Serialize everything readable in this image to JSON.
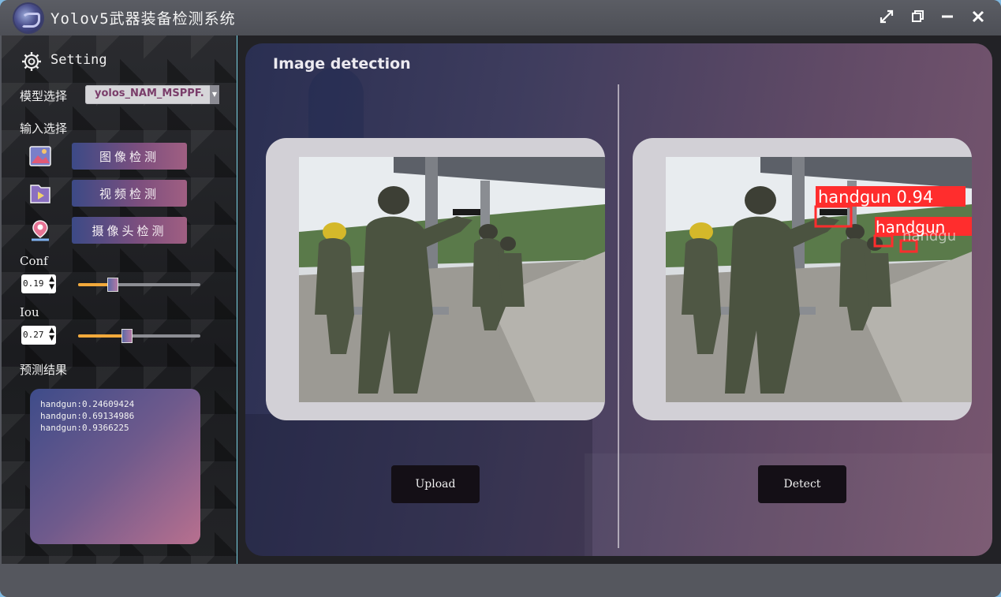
{
  "app": {
    "title": "Yolov5武器装备检测系统"
  },
  "window_controls": [
    "maximize-icon",
    "restore-icon",
    "minimize-icon",
    "close-icon"
  ],
  "sidebar": {
    "setting_label": "Setting",
    "model_label": "模型选择",
    "model_value": "yolos_NAM_MSPPF.",
    "input_label": "输入选择",
    "modes": [
      {
        "label": "图像检测",
        "icon": "image-detect-icon"
      },
      {
        "label": "视频检测",
        "icon": "video-detect-icon"
      },
      {
        "label": "摄像头检测",
        "icon": "camera-detect-icon"
      }
    ],
    "conf": {
      "label": "Conf",
      "value": "0.19",
      "level": 0.19
    },
    "iou": {
      "label": "Iou",
      "value": "0.27",
      "level": 0.27
    },
    "result_label": "预测结果",
    "results": [
      "handgun:0.24609424",
      "handgun:0.69134986",
      "handgun:0.9366225"
    ]
  },
  "main": {
    "title": "Image detection",
    "upload_label": "Upload",
    "detect_label": "Detect",
    "detections": [
      {
        "label": "handgun 0.94"
      },
      {
        "label": "handgun"
      },
      {
        "label": "handgu"
      }
    ]
  },
  "colors": {
    "accent": "#f2a93b",
    "detection_box": "#ff2d2d",
    "button_bg": "#140f16"
  }
}
